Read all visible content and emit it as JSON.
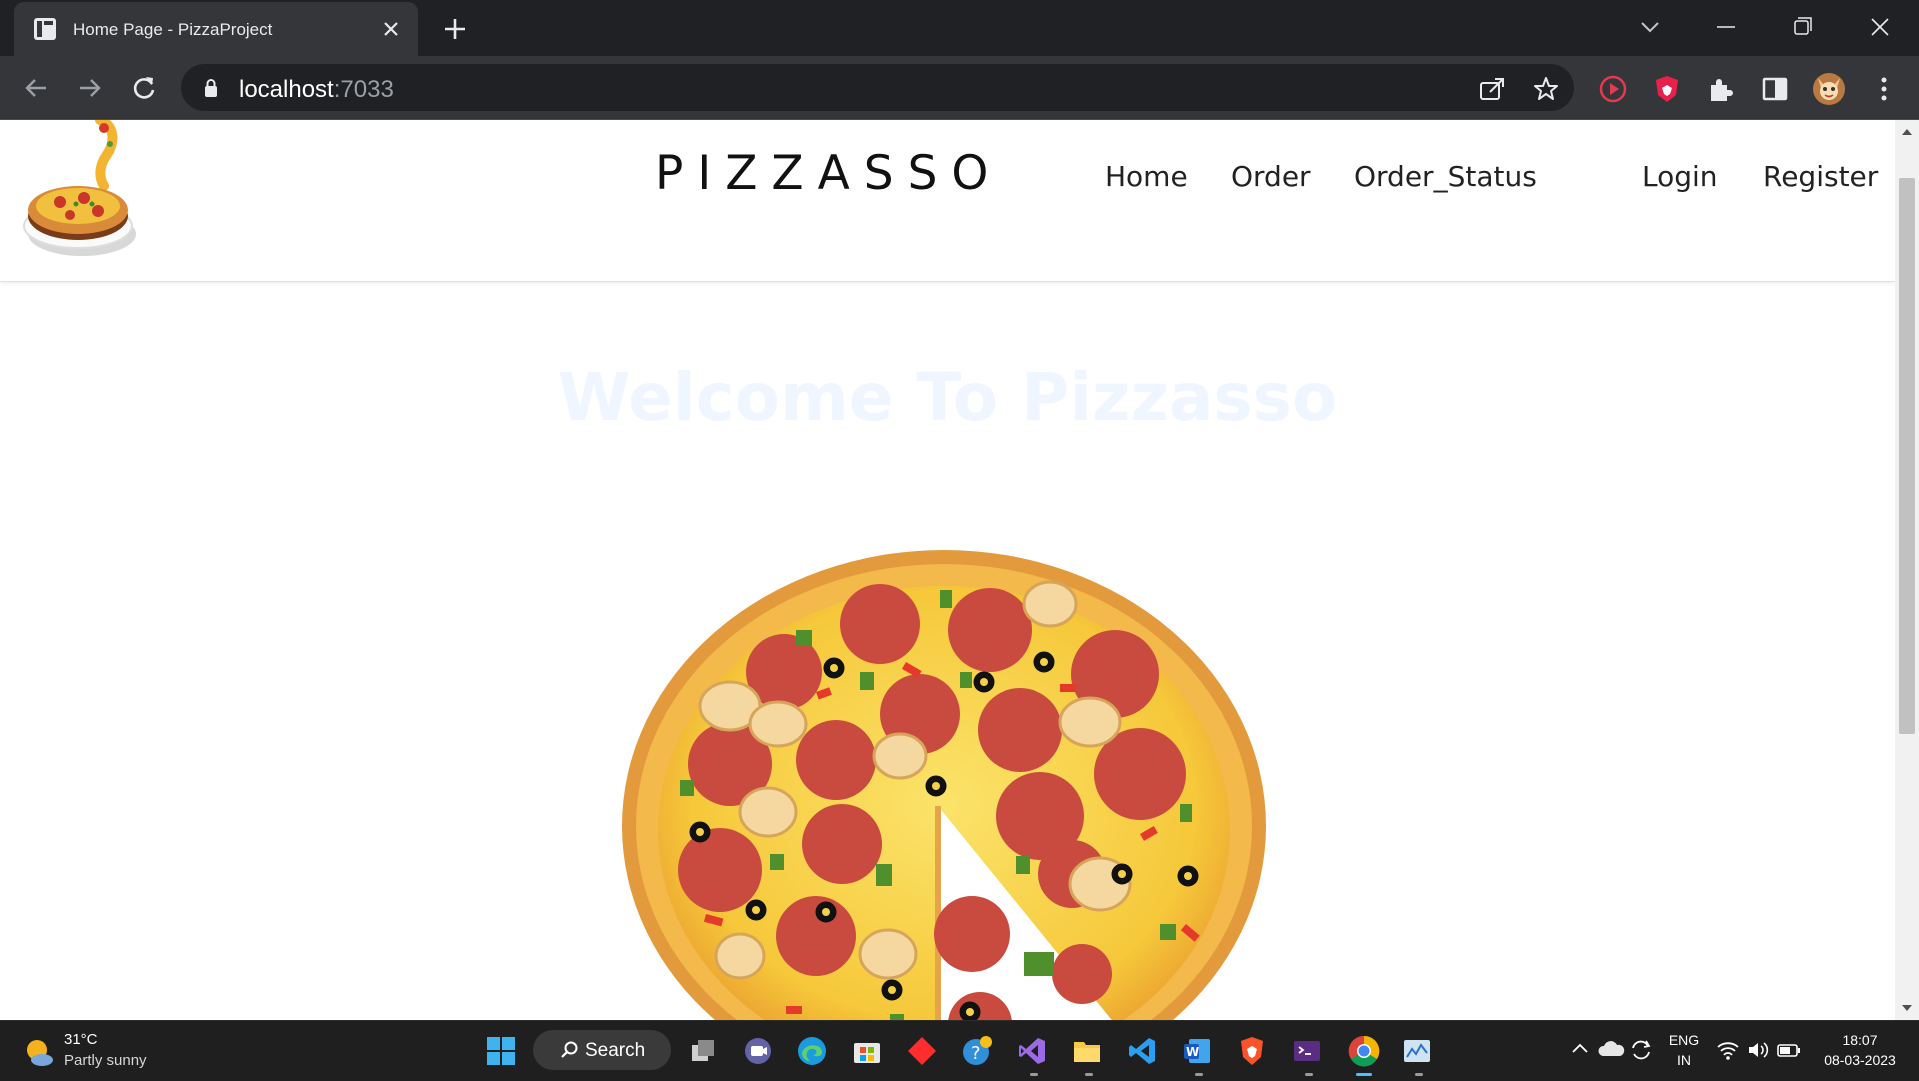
{
  "browser": {
    "tab_title": "Home Page - PizzaProject",
    "url_host": "localhost",
    "url_port": ":7033"
  },
  "site": {
    "brand": "PIZZASSO",
    "nav": {
      "home": "Home",
      "order": "Order",
      "order_status": "Order_Status",
      "login": "Login",
      "register": "Register"
    },
    "welcome": "Welcome To Pizzasso"
  },
  "taskbar": {
    "weather_temp": "31°C",
    "weather_desc": "Partly sunny",
    "search_label": "Search",
    "lang_top": "ENG",
    "lang_bottom": "IN",
    "time": "18:07",
    "date": "08-03-2023"
  },
  "colors": {
    "chrome_dark": "#202124",
    "chrome_toolbar": "#35363a",
    "taskbar": "#1f1f1f",
    "accent_active": "#4cc2ff"
  }
}
